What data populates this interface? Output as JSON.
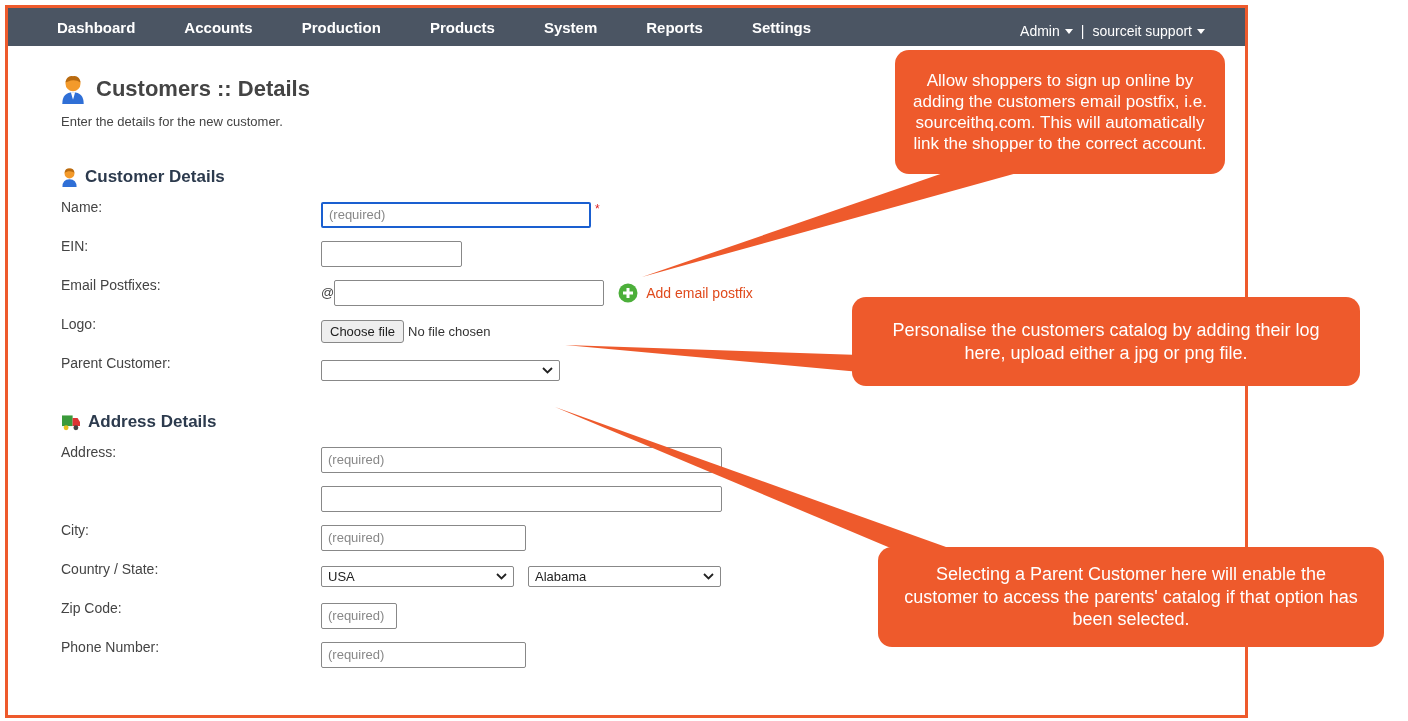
{
  "nav": {
    "items": [
      {
        "label": "Dashboard"
      },
      {
        "label": "Accounts"
      },
      {
        "label": "Production"
      },
      {
        "label": "Products"
      },
      {
        "label": "System"
      },
      {
        "label": "Reports"
      },
      {
        "label": "Settings"
      }
    ],
    "user_menu": [
      {
        "label": "Admin"
      },
      {
        "label": "sourceit support"
      }
    ],
    "separator": "|"
  },
  "page": {
    "title": "Customers :: Details",
    "subtitle": "Enter the details for the new customer."
  },
  "sections": [
    {
      "title": "Customer Details",
      "fields": [
        {
          "label": "Name:",
          "inputs": [
            {
              "kind": "text",
              "placeholder": "(required)",
              "focused": true
            }
          ],
          "required_mark": "*"
        },
        {
          "label": "EIN:",
          "inputs": [
            {
              "kind": "text",
              "focused": false
            }
          ]
        },
        {
          "label": "Email Postfixes:",
          "prefix": "@",
          "inputs": [
            {
              "kind": "text",
              "focused": false
            }
          ],
          "link": "Add email postfix"
        },
        {
          "label": "Logo:",
          "inputs": [
            {
              "kind": "file",
              "button": "Choose file",
              "status": "No file chosen"
            }
          ]
        },
        {
          "label": "Parent Customer:",
          "inputs": [
            {
              "kind": "select"
            }
          ]
        }
      ]
    },
    {
      "title": "Address Details",
      "fields": [
        {
          "label": "Address:",
          "inputs": [
            {
              "kind": "text",
              "placeholder": "(required)",
              "focused": false
            }
          ]
        },
        {
          "inputs": [
            {
              "kind": "text",
              "focused": false
            }
          ]
        },
        {
          "label": "City:",
          "inputs": [
            {
              "kind": "text",
              "placeholder": "(required)",
              "focused": false
            }
          ]
        },
        {
          "label": "Country / State:",
          "inputs": [
            {
              "kind": "select",
              "value": "USA"
            },
            {
              "kind": "select",
              "value": "Alabama"
            }
          ]
        },
        {
          "label": "Zip Code:",
          "inputs": [
            {
              "kind": "text",
              "placeholder": "(required)",
              "focused": false
            }
          ]
        },
        {
          "label": "Phone Number:",
          "inputs": [
            {
              "kind": "text",
              "placeholder": "(required)",
              "focused": false
            }
          ]
        }
      ]
    }
  ],
  "callouts": [
    {
      "text": "Allow shoppers to sign up online by adding the customers email postfix, i.e. sourceithq.com. This will automatically link the shopper to the correct account."
    },
    {
      "text": "Personalise the customers catalog by adding their log here, upload either a jpg or png file."
    },
    {
      "text": "Selecting a Parent Customer here will enable the customer to access the parents' catalog if that option has been selected."
    }
  ]
}
